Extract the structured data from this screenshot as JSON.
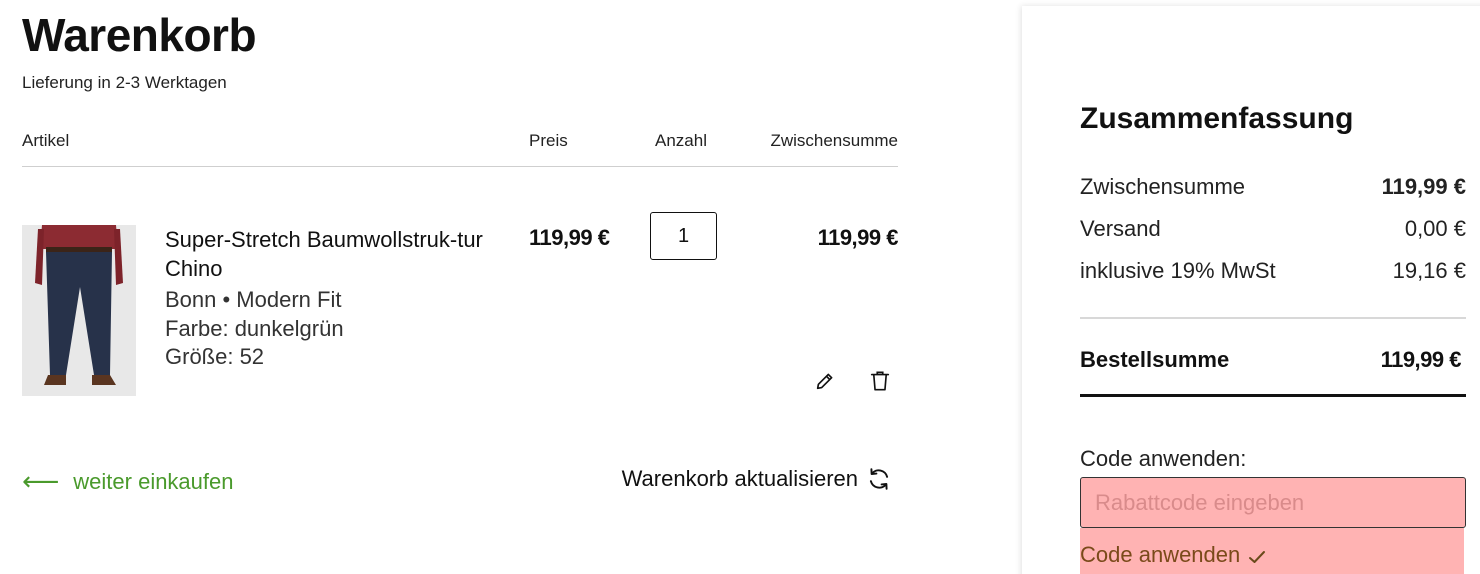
{
  "cart": {
    "title": "Warenkorb",
    "delivery": "Lieferung in 2-3 Werktagen",
    "columns": {
      "article": "Artikel",
      "price": "Preis",
      "quantity": "Anzahl",
      "subtotal": "Zwischensumme"
    },
    "item": {
      "name": "Super-Stretch Baumwollstruk-tur Chino",
      "line": "Bonn • Modern Fit",
      "color": "Farbe: dunkelgrün",
      "size": "Größe:  52",
      "price": "119,99 €",
      "quantity": "1",
      "subtotal": "119,99 €"
    },
    "continue_label": "weiter einkaufen",
    "update_label": "Warenkorb aktualisieren"
  },
  "summary": {
    "title": "Zusammenfassung",
    "rows": [
      {
        "label": "Zwischensumme",
        "value": "119,99 €"
      },
      {
        "label": "Versand",
        "value": "0,00 €"
      },
      {
        "label": "inklusive 19% MwSt",
        "value": "19,16 €"
      }
    ],
    "total_label": "Bestellsumme",
    "total_value": "119,99 €",
    "code_label": "Code anwenden:",
    "code_placeholder": "Rabattcode eingeben",
    "code_button": "Code anwenden"
  },
  "colors": {
    "accent_green": "#4a9a2c",
    "coupon_highlight": "#ffb3b3"
  },
  "icons": {
    "continue": "arrow-left-icon",
    "update": "refresh-icon",
    "edit": "pencil-icon",
    "delete": "trash-icon",
    "apply": "check-icon"
  }
}
